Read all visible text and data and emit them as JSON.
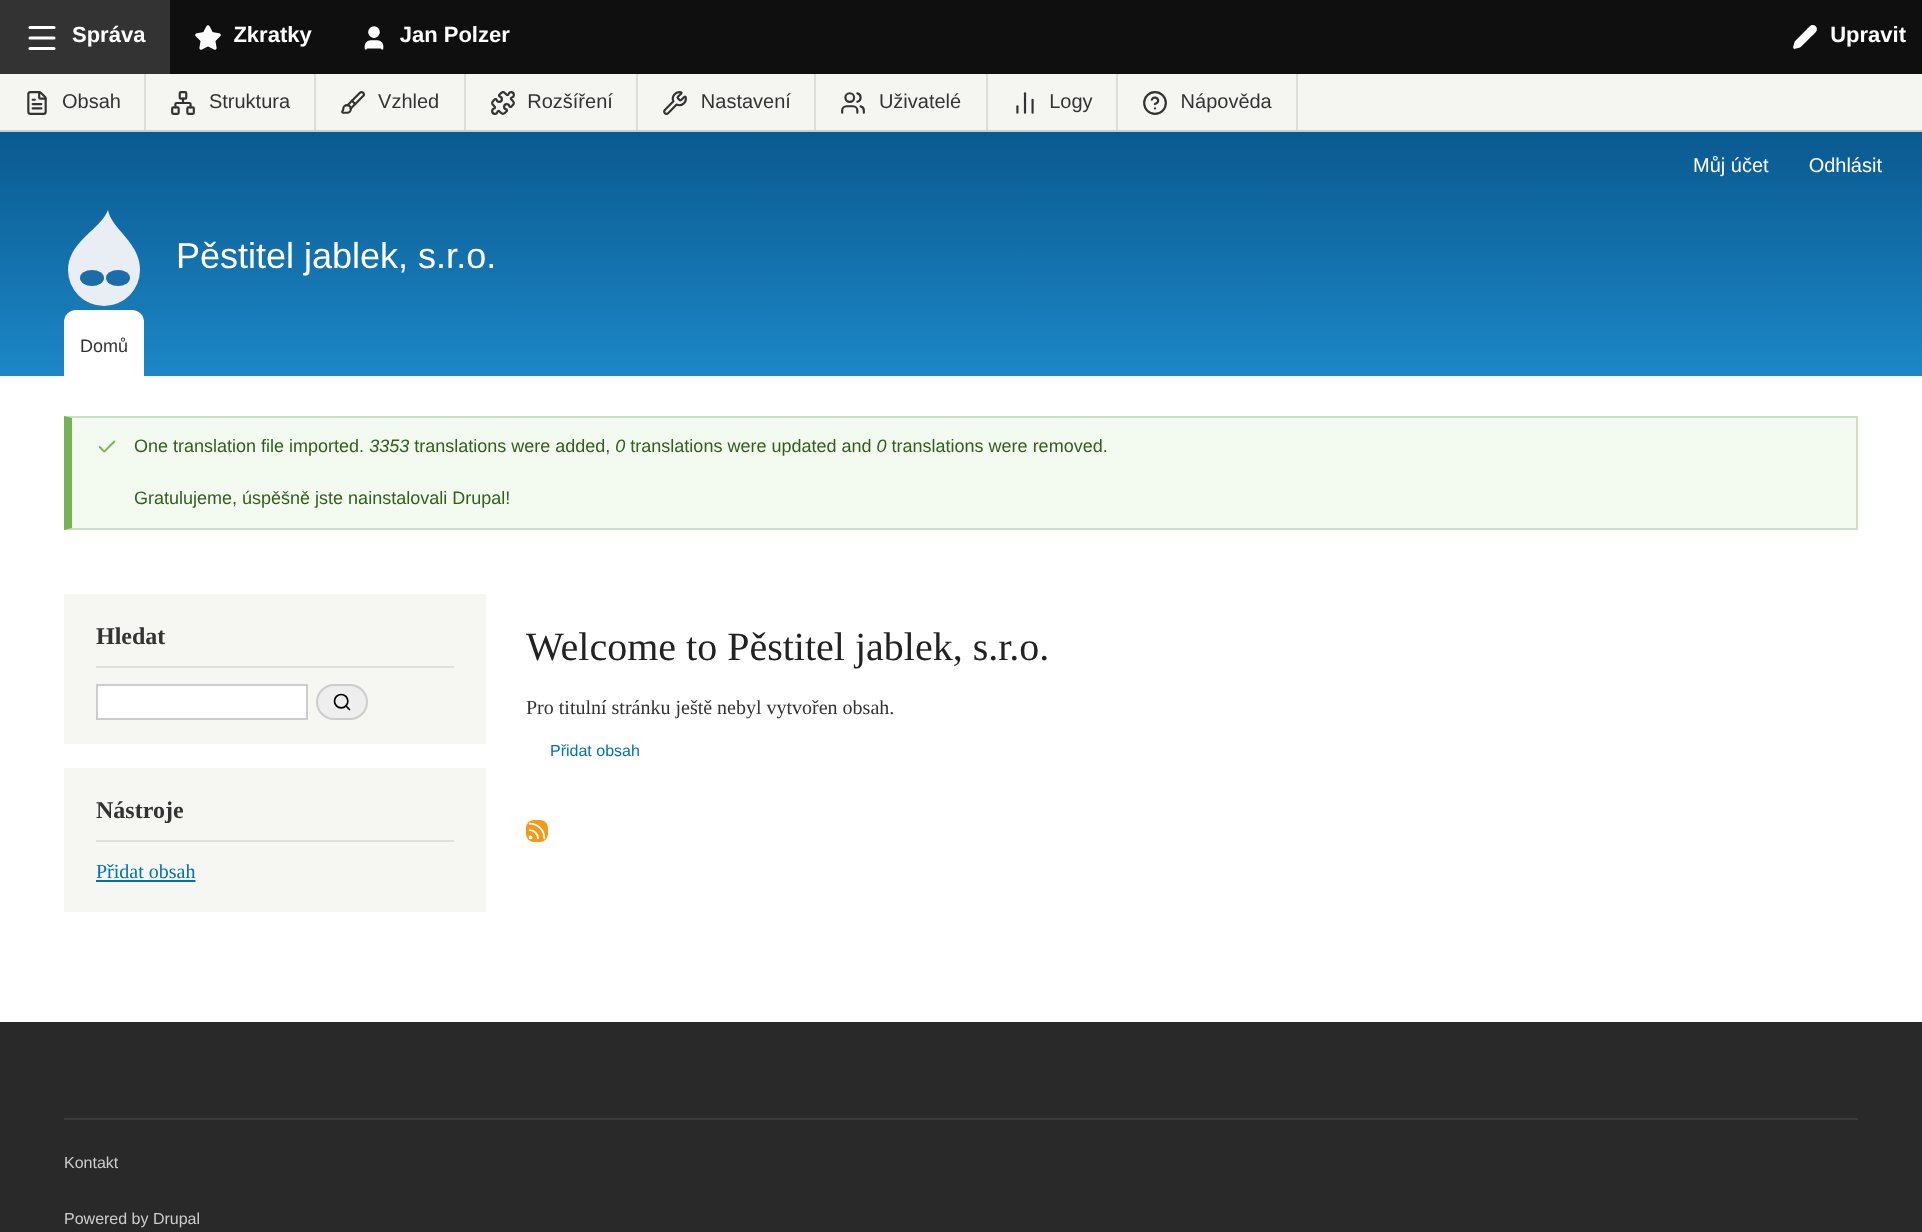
{
  "toolbar": {
    "items": [
      {
        "label": "Správa",
        "selected": true
      },
      {
        "label": "Zkratky",
        "selected": false
      },
      {
        "label": "Jan Polzer",
        "selected": false
      }
    ],
    "edit": "Upravit"
  },
  "admin_menu": [
    {
      "label": "Obsah"
    },
    {
      "label": "Struktura"
    },
    {
      "label": "Vzhled"
    },
    {
      "label": "Rozšíření"
    },
    {
      "label": "Nastavení"
    },
    {
      "label": "Uživatelé"
    },
    {
      "label": "Logy"
    },
    {
      "label": "Nápověda"
    }
  ],
  "header": {
    "user_links": [
      "Můj účet",
      "Odhlásit"
    ],
    "site_name": "Pěstitel jablek, s.r.o.",
    "tabs": [
      {
        "label": "Domů",
        "selected": true
      }
    ]
  },
  "messages": [
    "One translation file imported. *3353* translations were added, *0* translations were updated and *0* translations were removed.",
    "Gratulujeme, úspěšně jste nainstalovali Drupal!"
  ],
  "sidebar": {
    "search": {
      "title": "Hledat"
    },
    "tools": {
      "title": "Nástroje",
      "links": [
        "Přidat obsah"
      ]
    }
  },
  "main": {
    "title": "Welcome to Pěstitel jablek, s.r.o.",
    "text": "Pro titulní stránku ještě nebyl vytvořen obsah.",
    "link": "Přidat obsah"
  },
  "footer": {
    "links": [
      "Kontakt",
      "Powered by Drupal"
    ]
  }
}
